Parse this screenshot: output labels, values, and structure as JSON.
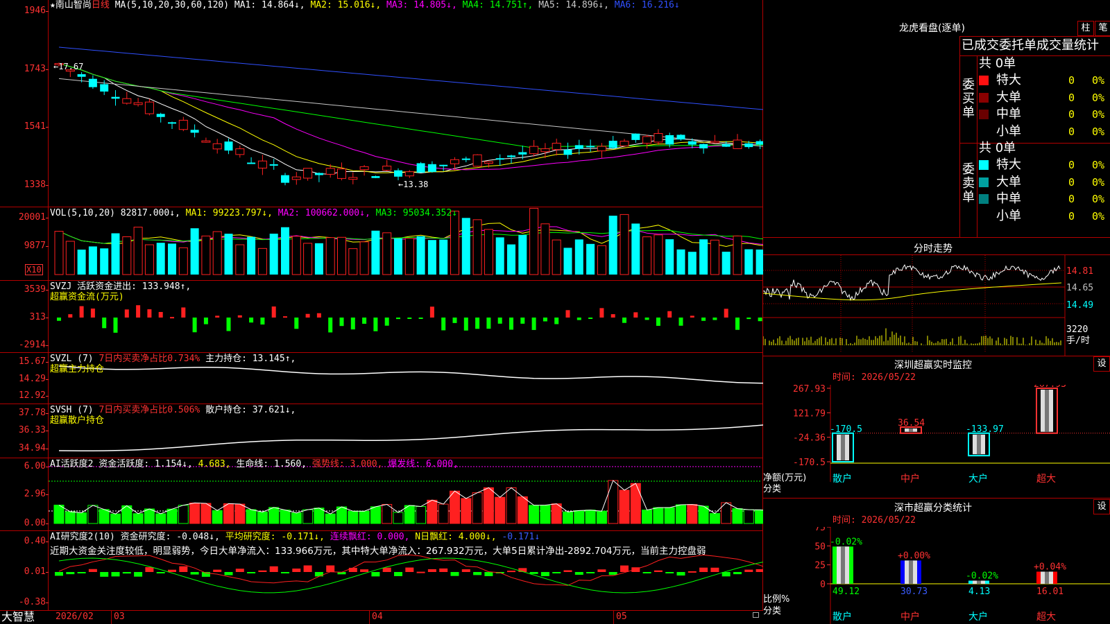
{
  "stock": {
    "name": "南山智尚",
    "period": "日线",
    "star": "★"
  },
  "app_name": "大智慧",
  "colors": {
    "up": "#ff2020",
    "down": "#00ffff",
    "grid": "#b40000"
  },
  "price": {
    "ma_legend": "MA(5,10,20,30,60,120)",
    "mas": [
      {
        "label": "MA1: 14.864↓,",
        "color": "#ffffff"
      },
      {
        "label": "MA2: 15.016↓,",
        "color": "#ffff00"
      },
      {
        "label": "MA3: 14.805↓,",
        "color": "#ff00ff"
      },
      {
        "label": "MA4: 14.751↑,",
        "color": "#00ff00"
      },
      {
        "label": "MA5: 14.896↓,",
        "color": "#c8c8c8"
      },
      {
        "label": "MA6: 16.216↓",
        "color": "#3050ff"
      }
    ],
    "yticks": [
      "1946",
      "1743",
      "1541",
      "1338"
    ],
    "high_mark": "17.67",
    "low_mark": "13.38"
  },
  "vol": {
    "label": "VOL(5,10,20)",
    "value": "82817.000↓,",
    "ma1": "MA1: 99223.797↓,",
    "ma2": "MA2: 100662.000↓,",
    "ma3": "MA3: 95034.352↓",
    "yticks": [
      "20001",
      "9877"
    ],
    "unit": "X10"
  },
  "svzj": {
    "label": "SVZJ",
    "text": "活跃资金进出: 133.948↑,",
    "sub": "超赢资金流(万元)",
    "yticks": [
      "3539",
      "313",
      "-2914"
    ]
  },
  "svzl": {
    "label": "SVZL (7)",
    "text1": "7日内买卖净占比0.734%",
    "text2": "主力持仓: 13.145↑,",
    "sub": "超赢主力持仓",
    "yticks": [
      "15.67",
      "14.29",
      "12.92"
    ]
  },
  "svsh": {
    "label": "SVSH (7)",
    "text1": "7日内买卖净占比0.506%",
    "text2": "散户持仓: 37.621↓,",
    "sub": "超赢散户持仓",
    "yticks": [
      "37.78",
      "36.33",
      "34.94"
    ]
  },
  "ai1": {
    "label": "AI活跃度2",
    "t1": "资金活跃度: 1.154↓,",
    "t2": "4.683,",
    "t3": "生命线: 1.560,",
    "t4": "强势线: 3.000,",
    "t5": "爆发线: 6.000,",
    "yticks": [
      "6.00",
      "2.96",
      "0.00"
    ]
  },
  "ai2": {
    "label": "AI研究度2(10)",
    "t1": "资金研究度: -0.048↓,",
    "t2": "平均研究度: -0.171↓,",
    "t3": "连续飘红: 0.000,",
    "t4": "N日飘红: 4.000↓,",
    "t5": "-0.171↓",
    "comment": "近期大资金关注度较低，明显弱势，今日大单净流入：133.966万元，其中特大单净流入：267.932万元，大单5日累计净出-2892.704万元，当前主力控盘弱",
    "yticks": [
      "0.40",
      "0.01",
      "-0.38"
    ]
  },
  "xaxis": [
    "2026/02",
    "03",
    "04",
    "05"
  ],
  "lhb": {
    "title": "龙虎看盘(逐单)",
    "btn1": "柱",
    "btn2": "笔",
    "header": "已成交委托单成交量统计",
    "buy": {
      "side": "委买单",
      "total": "共 0单",
      "rows": [
        {
          "name": "特大",
          "v": "0",
          "p": "0%"
        },
        {
          "name": "大单",
          "v": "0",
          "p": "0%"
        },
        {
          "name": "中单",
          "v": "0",
          "p": "0%"
        },
        {
          "name": "小单",
          "v": "0",
          "p": "0%"
        }
      ]
    },
    "sell": {
      "side": "委卖单",
      "total": "共 0单",
      "rows": [
        {
          "name": "特大",
          "v": "0",
          "p": "0%"
        },
        {
          "name": "大单",
          "v": "0",
          "p": "0%"
        },
        {
          "name": "中单",
          "v": "0",
          "p": "0%"
        },
        {
          "name": "小单",
          "v": "0",
          "p": "0%"
        }
      ]
    }
  },
  "fenshi": {
    "title": "分时走势",
    "yticks": [
      "14.81",
      "14.65",
      "14.49"
    ],
    "vol": "3220",
    "unit": "手/时"
  },
  "monitor": {
    "title": "深圳超赢实时监控",
    "btn": "设",
    "time": "时间: 2026/05/22",
    "yticks": [
      "267.93",
      "121.79",
      "-24.36",
      "-170.5"
    ],
    "ylabel1": "净额(万元)",
    "ylabel2": "分类",
    "bars": [
      {
        "cat": "散户",
        "value": -170.5,
        "label": "-170.5"
      },
      {
        "cat": "中户",
        "value": 36.54,
        "label": "36.54"
      },
      {
        "cat": "大户",
        "value": -133.97,
        "label": "-133.97"
      },
      {
        "cat": "超大",
        "value": 267.93,
        "label": "267.93"
      }
    ]
  },
  "classify": {
    "title": "深市超赢分类统计",
    "btn": "设",
    "time": "时间: 2026/05/22",
    "yticks": [
      "75",
      "50",
      "25",
      "0"
    ],
    "ylabel1": "比例%",
    "ylabel2": "分类",
    "bars": [
      {
        "cat": "散户",
        "value": 49.12,
        "label": "49.12",
        "chg": "-0.02%"
      },
      {
        "cat": "中户",
        "value": 30.73,
        "label": "30.73",
        "chg": "+0.00%"
      },
      {
        "cat": "大户",
        "value": 4.13,
        "label": "4.13",
        "chg": "-0.02%"
      },
      {
        "cat": "超大",
        "value": 16.01,
        "label": "16.01",
        "chg": "+0.04%"
      }
    ]
  }
}
